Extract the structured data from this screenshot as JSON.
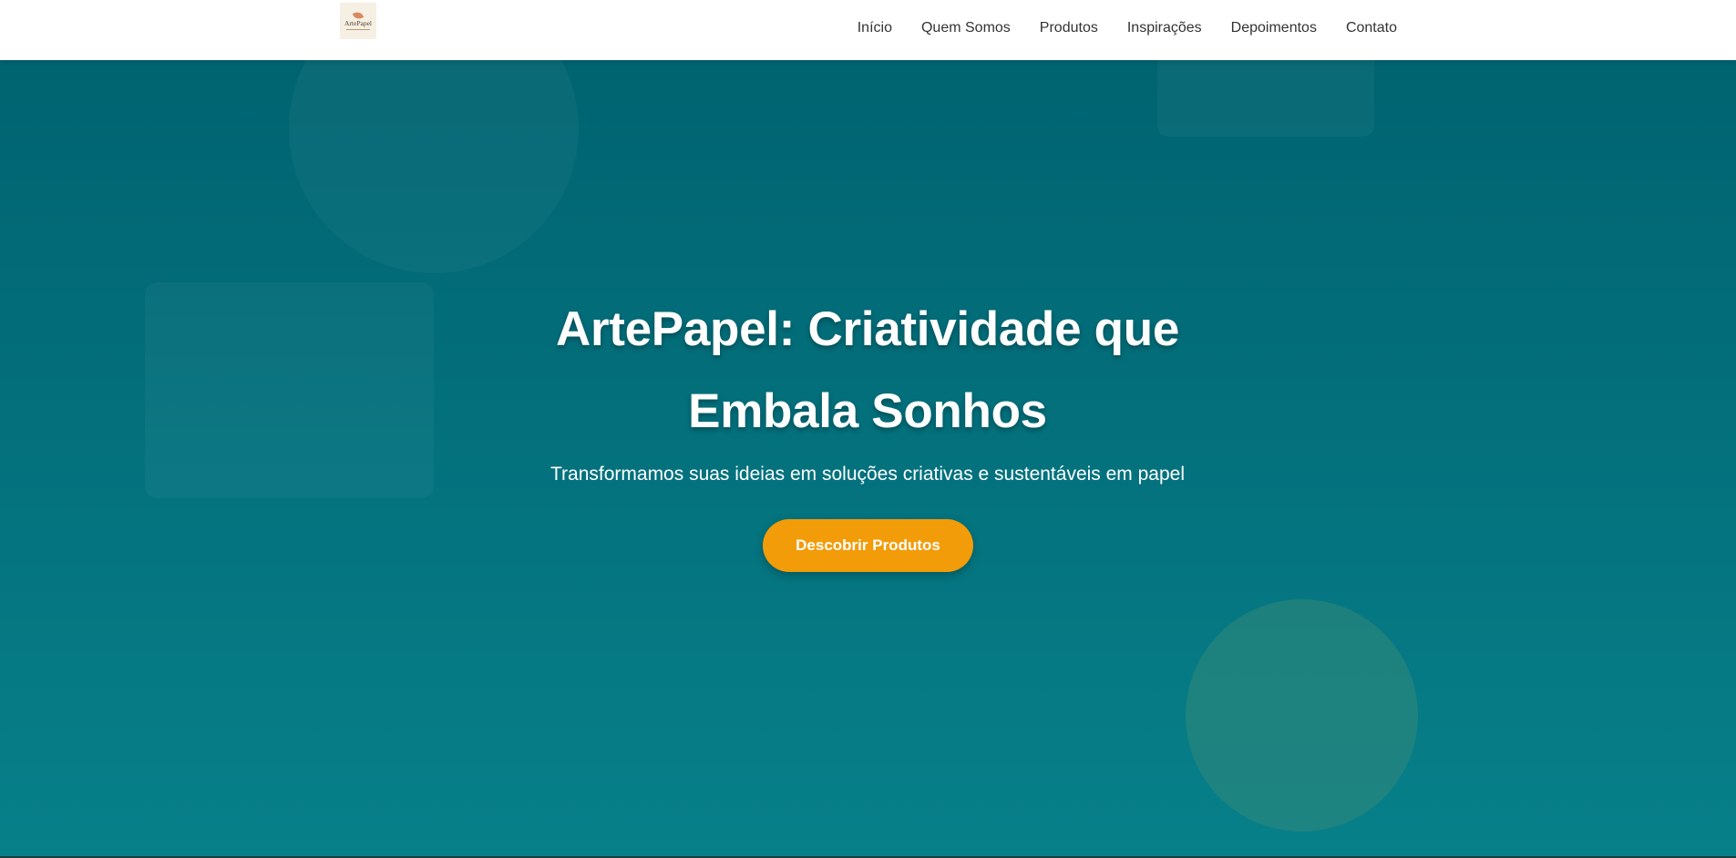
{
  "header": {
    "logo": {
      "text": "ArtePapel",
      "icon": "leaf-icon"
    },
    "nav": [
      {
        "label": "Início"
      },
      {
        "label": "Quem Somos"
      },
      {
        "label": "Produtos"
      },
      {
        "label": "Inspirações"
      },
      {
        "label": "Depoimentos"
      },
      {
        "label": "Contato"
      }
    ]
  },
  "hero": {
    "title": "ArtePapel: Criatividade que Embala Sonhos",
    "subtitle": "Transformamos suas ideias em soluções criativas e sustentáveis em papel",
    "cta_label": "Descobrir Produtos"
  },
  "colors": {
    "header_bg": "#ffffff",
    "nav_text": "#333333",
    "hero_gradient_top": "#006370",
    "hero_gradient_bottom": "#07808a",
    "cta_bg": "#f29c0a",
    "text_light": "#ffffff"
  }
}
